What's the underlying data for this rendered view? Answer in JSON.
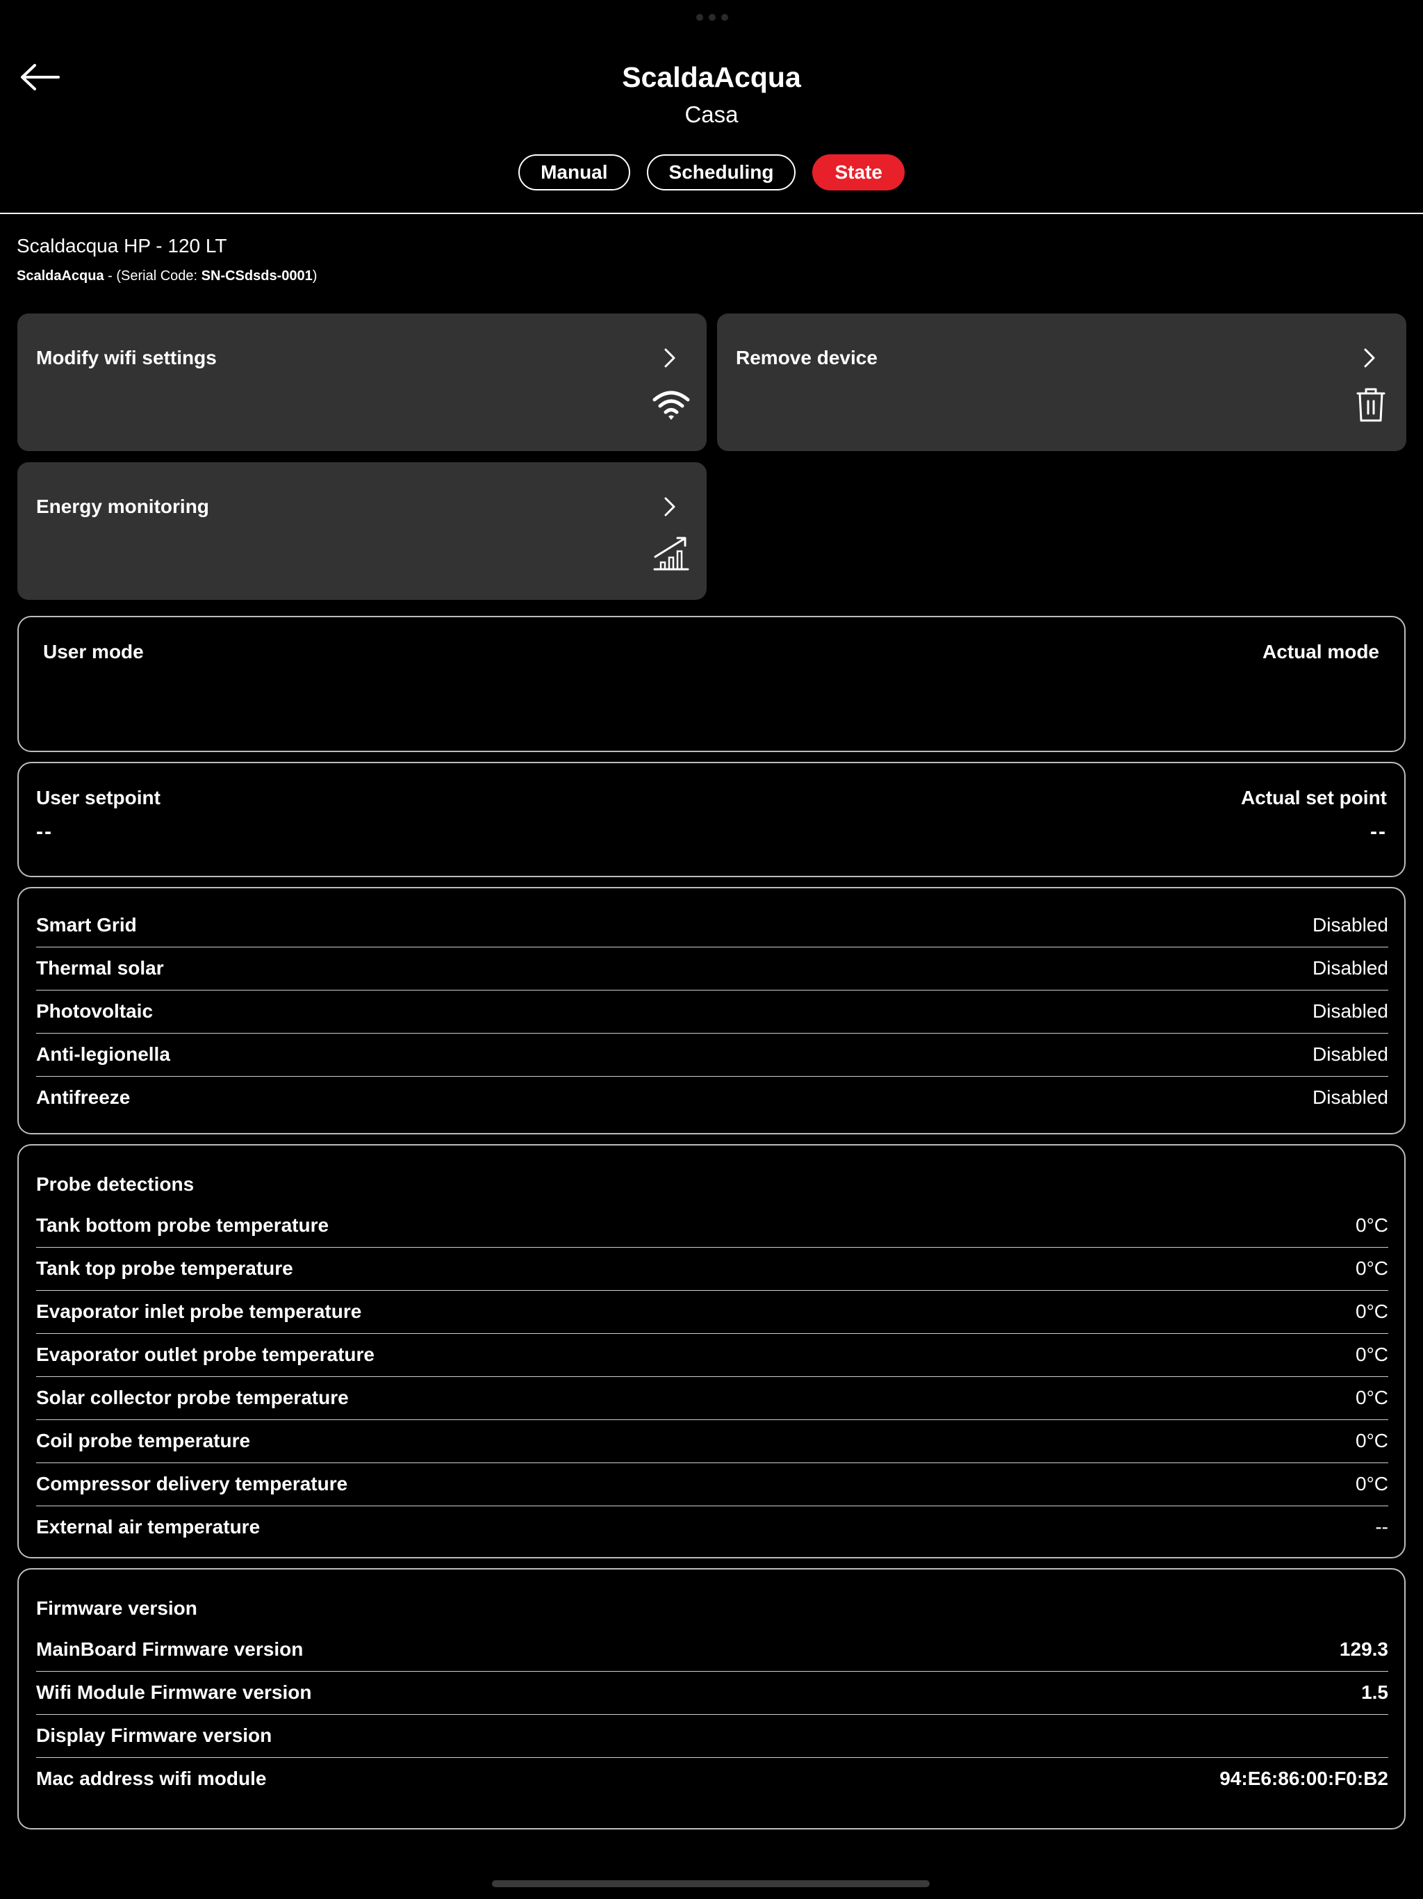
{
  "header": {
    "title": "ScaldaAcqua",
    "subtitle": "Casa",
    "tabs": [
      {
        "label": "Manual",
        "active": false
      },
      {
        "label": "Scheduling",
        "active": false
      },
      {
        "label": "State",
        "active": true
      }
    ]
  },
  "device": {
    "model": "Scaldacqua HP - 120 LT",
    "name": "ScaldaAcqua",
    "serial_prefix": " - (Serial Code: ",
    "serial_code": "SN-CSdsds-0001",
    "serial_suffix": ")"
  },
  "tiles": {
    "wifi": {
      "label": "Modify wifi settings",
      "icon": "wifi-icon"
    },
    "remove": {
      "label": "Remove device",
      "icon": "trash-icon"
    },
    "energy": {
      "label": "Energy monitoring",
      "icon": "chart-growth-icon"
    }
  },
  "mode": {
    "user_label": "User mode",
    "actual_label": "Actual mode"
  },
  "setpoint": {
    "user_label": "User setpoint",
    "user_value": "--",
    "actual_label": "Actual set point",
    "actual_value": "--"
  },
  "features": [
    {
      "label": "Smart Grid",
      "value": "Disabled"
    },
    {
      "label": "Thermal solar",
      "value": "Disabled"
    },
    {
      "label": "Photovoltaic",
      "value": "Disabled"
    },
    {
      "label": "Anti-legionella",
      "value": "Disabled"
    },
    {
      "label": "Antifreeze",
      "value": "Disabled"
    }
  ],
  "probes": {
    "title": "Probe detections",
    "items": [
      {
        "label": "Tank bottom probe temperature",
        "value": "0°C"
      },
      {
        "label": "Tank top probe temperature",
        "value": "0°C"
      },
      {
        "label": "Evaporator inlet probe temperature",
        "value": "0°C"
      },
      {
        "label": "Evaporator outlet probe temperature",
        "value": "0°C"
      },
      {
        "label": "Solar collector probe temperature",
        "value": "0°C"
      },
      {
        "label": "Coil probe temperature",
        "value": "0°C"
      },
      {
        "label": "Compressor delivery temperature",
        "value": "0°C"
      },
      {
        "label": "External air temperature",
        "value": "--"
      }
    ]
  },
  "firmware": {
    "title": "Firmware version",
    "items": [
      {
        "label": "MainBoard Firmware version",
        "value": "129.3"
      },
      {
        "label": "Wifi Module Firmware version",
        "value": "1.5"
      },
      {
        "label": "Display Firmware version",
        "value": ""
      },
      {
        "label": "Mac address wifi module",
        "value": "94:E6:86:00:F0:B2"
      }
    ]
  },
  "colors": {
    "accent": "#e8202a",
    "tile_bg": "#333333",
    "background": "#000000"
  }
}
